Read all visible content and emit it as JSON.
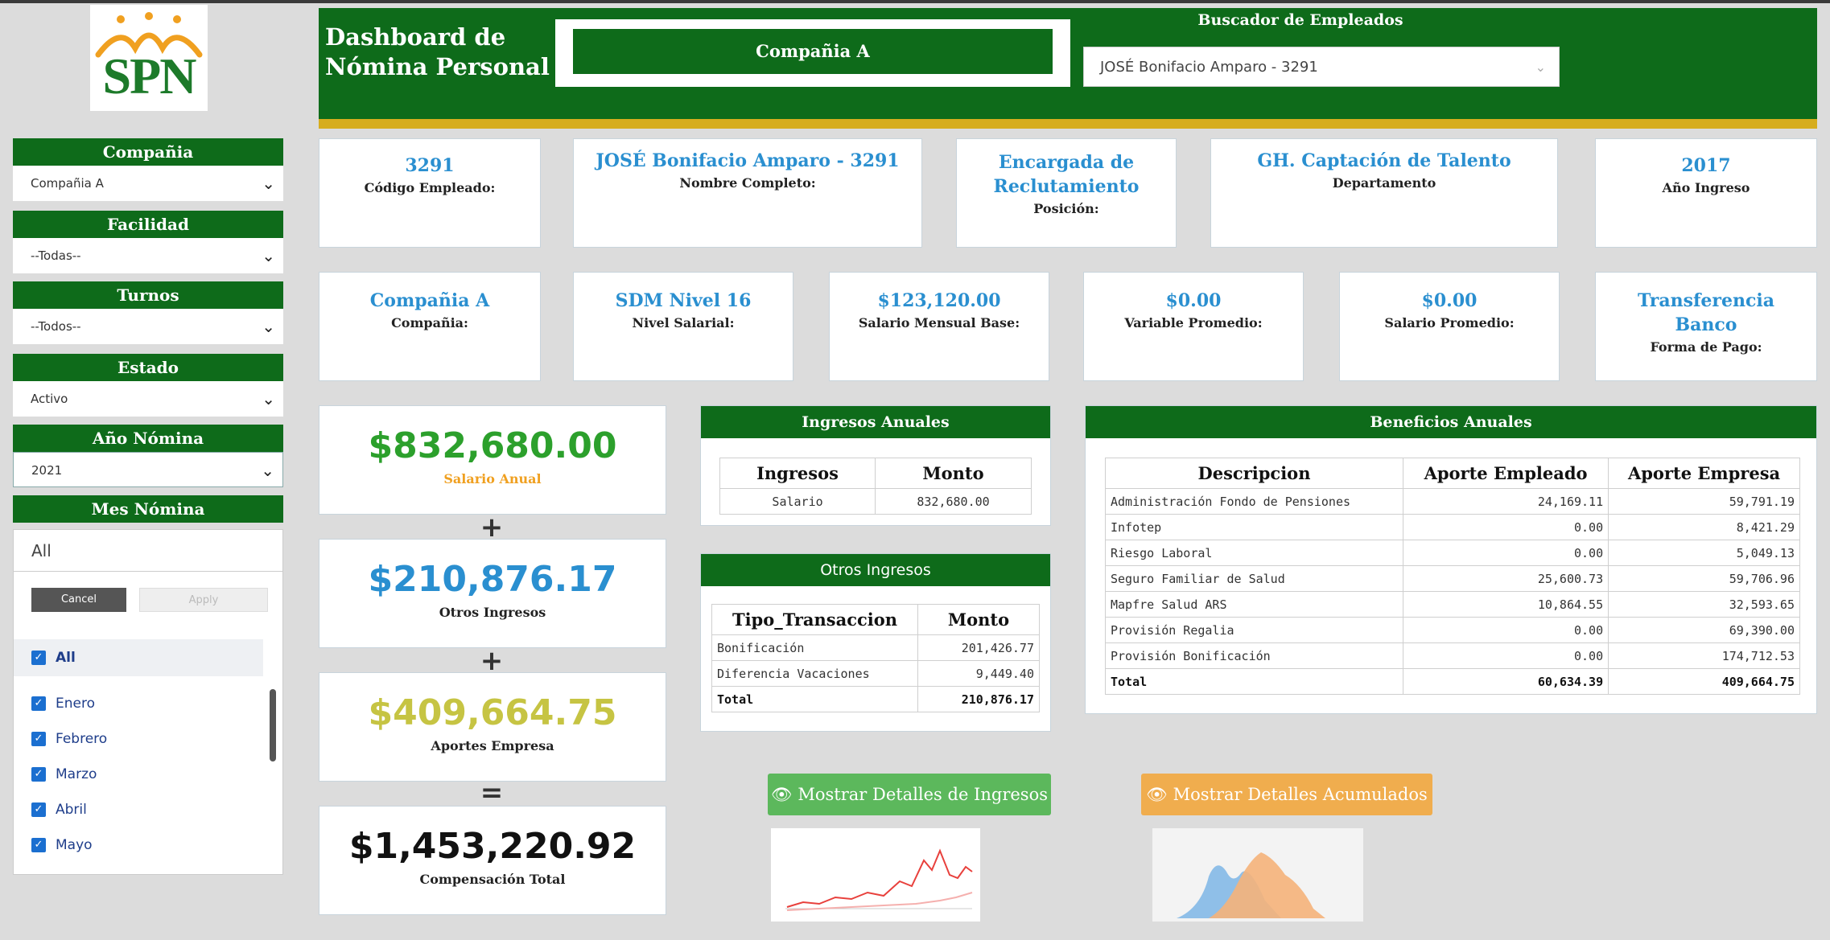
{
  "logo": {
    "text": "SPN"
  },
  "header": {
    "title_line1": "Dashboard de",
    "title_line2": "Nómina Personal",
    "company": "Compañia A",
    "search_label": "Buscador de Empleados",
    "search_value": "JOSÉ Bonifacio Amparo - 3291"
  },
  "filters": [
    {
      "label": "Compañia",
      "value": "Compañia A"
    },
    {
      "label": "Facilidad",
      "value": "--Todas--"
    },
    {
      "label": "Turnos",
      "value": "--Todos--"
    },
    {
      "label": "Estado",
      "value": "Activo"
    },
    {
      "label": "Año Nómina",
      "value": "2021"
    },
    {
      "label": "Mes Nómina",
      "value": "All"
    }
  ],
  "month_panel": {
    "cancel": "Cancel",
    "apply": "Apply",
    "all": "All",
    "months": [
      "Enero",
      "Febrero",
      "Marzo",
      "Abril",
      "Mayo"
    ]
  },
  "cards_row1": [
    {
      "value": "3291",
      "label": "Código Empleado:"
    },
    {
      "value": "JOSÉ Bonifacio Amparo - 3291",
      "label": "Nombre Completo:"
    },
    {
      "value_line1": "Encargada de",
      "value_line2": "Reclutamiento",
      "label": "Posición:"
    },
    {
      "value": "GH. Captación de Talento",
      "label": "Departamento"
    },
    {
      "value": "2017",
      "label": "Año Ingreso"
    }
  ],
  "cards_row2": [
    {
      "value": "Compañia A",
      "label": "Compañia:"
    },
    {
      "value": "SDM Nivel 16",
      "label": "Nivel Salarial:"
    },
    {
      "value": "$123,120.00",
      "label": "Salario Mensual Base:"
    },
    {
      "value": "$0.00",
      "label": "Variable Promedio:"
    },
    {
      "value": "$0.00",
      "label": "Salario Promedio:"
    },
    {
      "value_line1": "Transferencia",
      "value_line2": "Banco",
      "label": "Forma de Pago:"
    }
  ],
  "totals": [
    {
      "value": "$832,680.00",
      "label": "Salario Anual",
      "color": "#2ca02c",
      "label_color": "#f0a020"
    },
    {
      "value": "$210,876.17",
      "label": "Otros Ingresos",
      "color": "#2a8fd0",
      "label_color": "#222222"
    },
    {
      "value": "$409,664.75",
      "label": "Aportes Empresa",
      "color": "#c6c443",
      "label_color": "#222222"
    },
    {
      "value": "$1,453,220.92",
      "label": "Compensación Total",
      "color": "#111111",
      "label_color": "#222222"
    }
  ],
  "operators": [
    "+",
    "+",
    "="
  ],
  "ingresos_anuales": {
    "title": "Ingresos Anuales",
    "headers": [
      "Ingresos",
      "Monto"
    ],
    "rows": [
      [
        "Salario",
        "832,680.00"
      ]
    ]
  },
  "otros_ingresos": {
    "title": "Otros Ingresos",
    "headers": [
      "Tipo_Transaccion",
      "Monto"
    ],
    "rows": [
      [
        "Bonificación",
        "201,426.77"
      ],
      [
        "Diferencia Vacaciones",
        "9,449.40"
      ]
    ],
    "total": [
      "Total",
      "210,876.17"
    ]
  },
  "beneficios": {
    "title": "Beneficios Anuales",
    "headers": [
      "Descripcion",
      "Aporte Empleado",
      "Aporte Empresa"
    ],
    "rows": [
      [
        "Administración Fondo de Pensiones",
        "24,169.11",
        "59,791.19"
      ],
      [
        "Infotep",
        "0.00",
        "8,421.29"
      ],
      [
        "Riesgo Laboral",
        "0.00",
        "5,049.13"
      ],
      [
        "Seguro Familiar de Salud",
        "25,600.73",
        "59,706.96"
      ],
      [
        "Mapfre Salud ARS",
        "10,864.55",
        "32,593.65"
      ],
      [
        "Provisión Regalia",
        "0.00",
        "69,390.00"
      ],
      [
        "Provisión Bonificación",
        "0.00",
        "174,712.53"
      ]
    ],
    "total": [
      "Total",
      "60,634.39",
      "409,664.75"
    ]
  },
  "buttons": {
    "ingresos": "Mostrar Detalles de Ingresos",
    "acumulados": "Mostrar Detalles Acumulados",
    "ingresos_color": "#5cb85c",
    "acumulados_color": "#f0ad4e"
  }
}
